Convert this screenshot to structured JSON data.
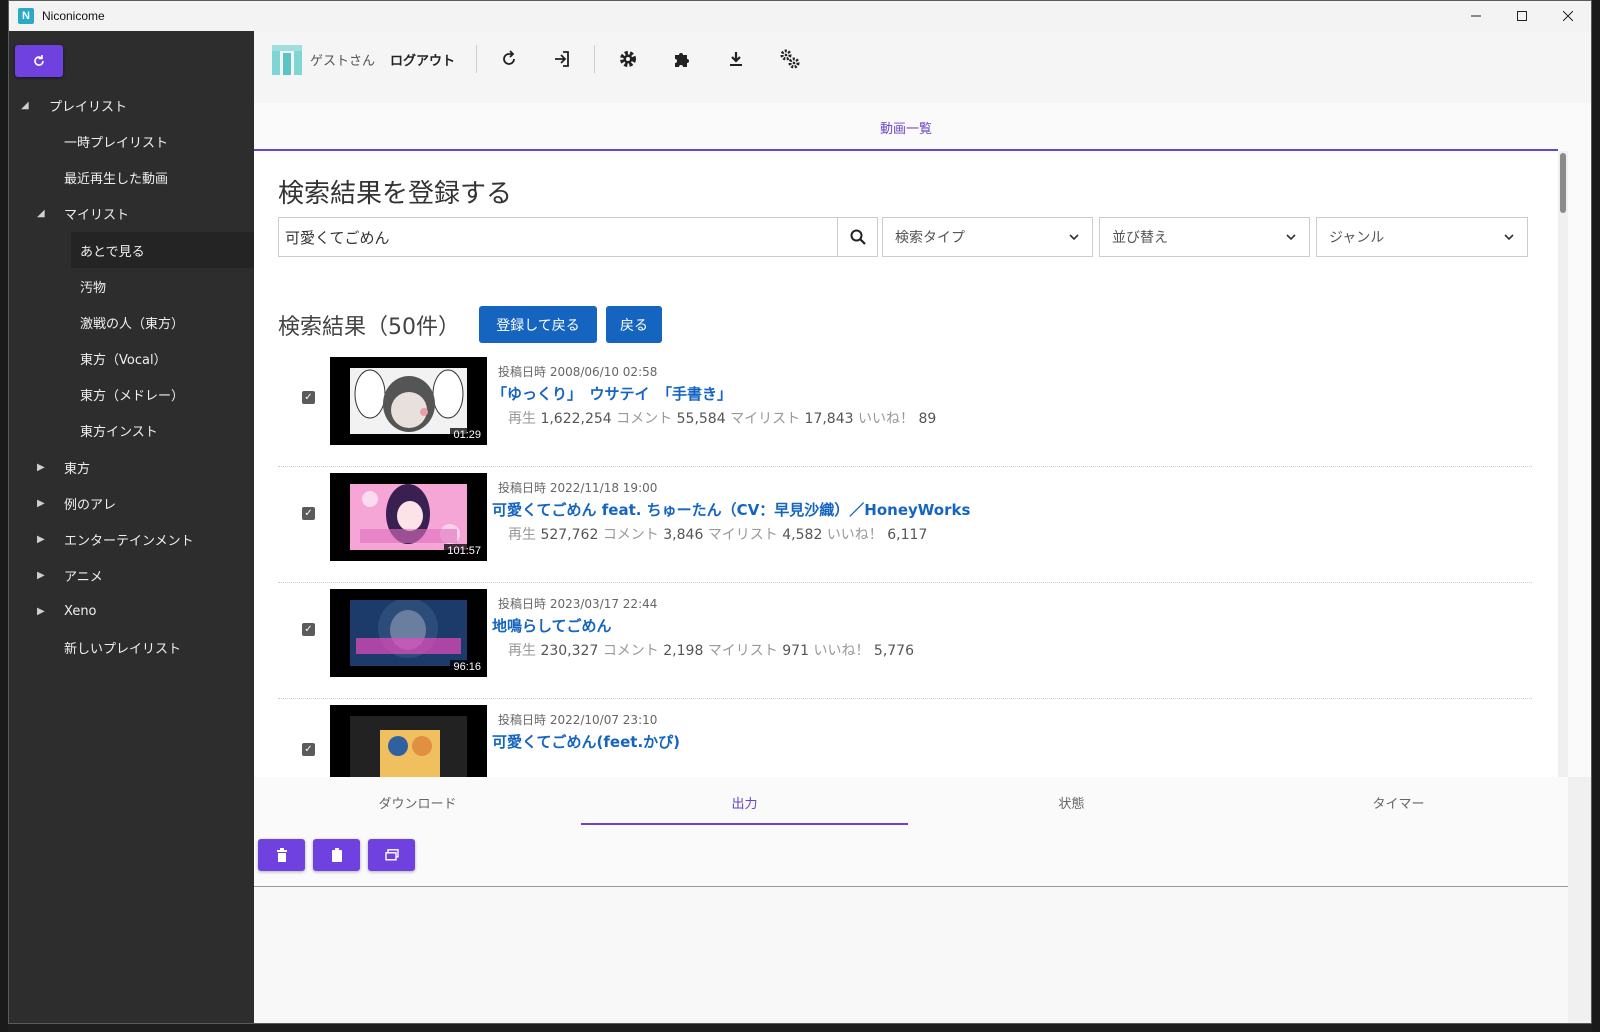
{
  "window": {
    "title": "Niconicome"
  },
  "sidebar": {
    "items": [
      {
        "label": "プレイリスト"
      },
      {
        "label": "一時プレイリスト"
      },
      {
        "label": "最近再生した動画"
      },
      {
        "label": "マイリスト"
      },
      {
        "label": "あとで見る"
      },
      {
        "label": "汚物"
      },
      {
        "label": "激戦の人（東方）"
      },
      {
        "label": "東方（Vocal）"
      },
      {
        "label": "東方（メドレー）"
      },
      {
        "label": "東方インスト"
      },
      {
        "label": "東方"
      },
      {
        "label": "例のアレ"
      },
      {
        "label": "エンターテインメント"
      },
      {
        "label": "アニメ"
      },
      {
        "label": "Xeno"
      },
      {
        "label": "新しいプレイリスト"
      }
    ]
  },
  "toolbar": {
    "guest_label": "ゲストさん",
    "logout_label": "ログアウト"
  },
  "top_tab": {
    "label": "動画一覧"
  },
  "search": {
    "heading": "検索結果を登録する",
    "query": "可愛くてごめん",
    "type_label": "検索タイプ",
    "sort_label": "並び替え",
    "genre_label": "ジャンル"
  },
  "results": {
    "heading": "検索結果（50件）",
    "register_back_label": "登録して戻る",
    "back_label": "戻る",
    "items": [
      {
        "posted": "投稿日時 2008/06/10 02:58",
        "title": "「ゆっくり」　ウサテイ　「手書き」",
        "duration": "01:29",
        "views_label": "再生",
        "views": "1,622,254",
        "comments_label": "コメント",
        "comments": "55,584",
        "mylist_label": "マイリスト",
        "mylist": "17,843",
        "likes_label": "いいね！",
        "likes": "89"
      },
      {
        "posted": "投稿日時 2022/11/18 19:00",
        "title": "可愛くてごめん feat. ちゅーたん（CV：早見沙織）／HoneyWorks",
        "duration": "101:57",
        "views_label": "再生",
        "views": "527,762",
        "comments_label": "コメント",
        "comments": "3,846",
        "mylist_label": "マイリスト",
        "mylist": "4,582",
        "likes_label": "いいね！",
        "likes": "6,117"
      },
      {
        "posted": "投稿日時 2023/03/17 22:44",
        "title": "地鳴らしてごめん",
        "duration": "96:16",
        "views_label": "再生",
        "views": "230,327",
        "comments_label": "コメント",
        "comments": "2,198",
        "mylist_label": "マイリスト",
        "mylist": "971",
        "likes_label": "いいね！",
        "likes": "5,776"
      },
      {
        "posted": "投稿日時 2022/10/07 23:10",
        "title": "可愛くてごめん(feet.かぴ)"
      }
    ]
  },
  "bottom_tabs": {
    "download": "ダウンロード",
    "output": "出力",
    "status": "状態",
    "timer": "タイマー"
  },
  "colors": {
    "accent": "#6f42e0",
    "link": "#1565c0",
    "sidebar_bg": "#2d2d2d"
  }
}
